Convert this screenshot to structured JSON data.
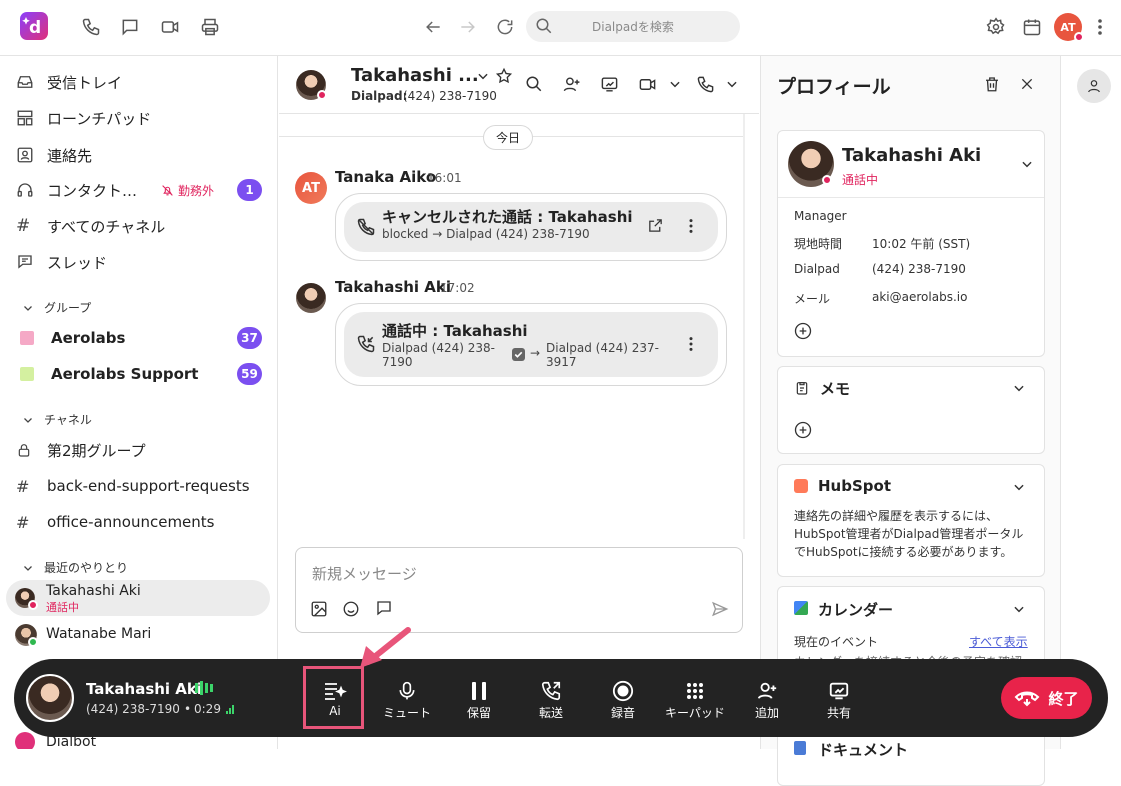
{
  "topbar": {
    "search_placeholder": "Dialpadを検索",
    "user_initials": "AT"
  },
  "sidebar": {
    "nav": [
      {
        "label": "受信トレイ",
        "icon": "inbox-icon"
      },
      {
        "label": "ローンチパッド",
        "icon": "launchpad-icon"
      },
      {
        "label": "連絡先",
        "icon": "contacts-icon"
      },
      {
        "label": "コンタクト…",
        "icon": "headset-icon",
        "status": "勤務外",
        "badge": "1"
      },
      {
        "label": "すべてのチャネル",
        "icon": "hash-icon"
      },
      {
        "label": "スレッド",
        "icon": "threads-icon"
      }
    ],
    "groups_header": "グループ",
    "groups": [
      {
        "label": "Aerolabs",
        "badge": "37",
        "color": "#f5a9c6"
      },
      {
        "label": "Aerolabs Support",
        "badge": "59",
        "color": "#d4f0a0"
      }
    ],
    "channels_header": "チャネル",
    "channels": [
      {
        "label": "第2期グループ",
        "icon": "lock-icon"
      },
      {
        "label": "back-end-support-requests",
        "icon": "hash-icon"
      },
      {
        "label": "office-announcements",
        "icon": "hash-icon"
      }
    ],
    "recent_header": "最近のやりとり",
    "recent": [
      {
        "name": "Takahashi Aki",
        "status": "通話中"
      },
      {
        "name": "Watanabe Mari"
      },
      {
        "name": "Dialbot"
      }
    ]
  },
  "chat": {
    "contact_name": "Takahashi ...",
    "contact_sub_label": "Dialpad:",
    "contact_sub_number": "(424) 238-7190",
    "today_label": "今日",
    "messages": [
      {
        "sender": "Tanaka Aiko",
        "time": "16:01",
        "initials": "AT",
        "title": "キャンセルされた通話 : Takahashi",
        "detail": "blocked → Dialpad (424) 238-7190"
      },
      {
        "sender": "Takahashi Aki",
        "time": "17:02",
        "title": "通話中 : Takahashi",
        "from": "Dialpad (424) 238-7190",
        "to": "Dialpad (424) 237-3917"
      }
    ],
    "composer_placeholder": "新規メッセージ"
  },
  "profile": {
    "header": "プロフィール",
    "name": "Takahashi Aki",
    "status": "通話中",
    "fields": [
      {
        "label": "Manager",
        "value": ""
      },
      {
        "label": "現地時間",
        "value": "10:02 午前 (SST)"
      },
      {
        "label": "Dialpad",
        "value": "(424) 238-7190"
      },
      {
        "label": "メール",
        "value": "aki@aerolabs.io"
      }
    ],
    "memo_title": "メモ",
    "hubspot_title": "HubSpot",
    "hubspot_text": "連絡先の詳細や履歴を表示するには、HubSpot管理者がDialpad管理者ポータルでHubSpotに接続する必要があります。",
    "calendar_title": "カレンダー",
    "calendar_current": "現在のイベント",
    "calendar_show_all": "すべて表示",
    "calendar_hint": "カレンダーを接続すると今後の予定を確認",
    "documents_title": "ドキュメント"
  },
  "callbar": {
    "name": "Takahashi Aki",
    "number": "(424) 238-7190",
    "timer": "0:29",
    "buttons": [
      {
        "label": "Ai",
        "icon": "ai-icon"
      },
      {
        "label": "ミュート",
        "icon": "mic-icon"
      },
      {
        "label": "保留",
        "icon": "pause-icon"
      },
      {
        "label": "転送",
        "icon": "transfer-icon"
      },
      {
        "label": "録音",
        "icon": "record-icon"
      },
      {
        "label": "キーパッド",
        "icon": "keypad-icon"
      },
      {
        "label": "追加",
        "icon": "add-person-icon"
      },
      {
        "label": "共有",
        "icon": "share-screen-icon"
      }
    ],
    "end_label": "終了"
  }
}
